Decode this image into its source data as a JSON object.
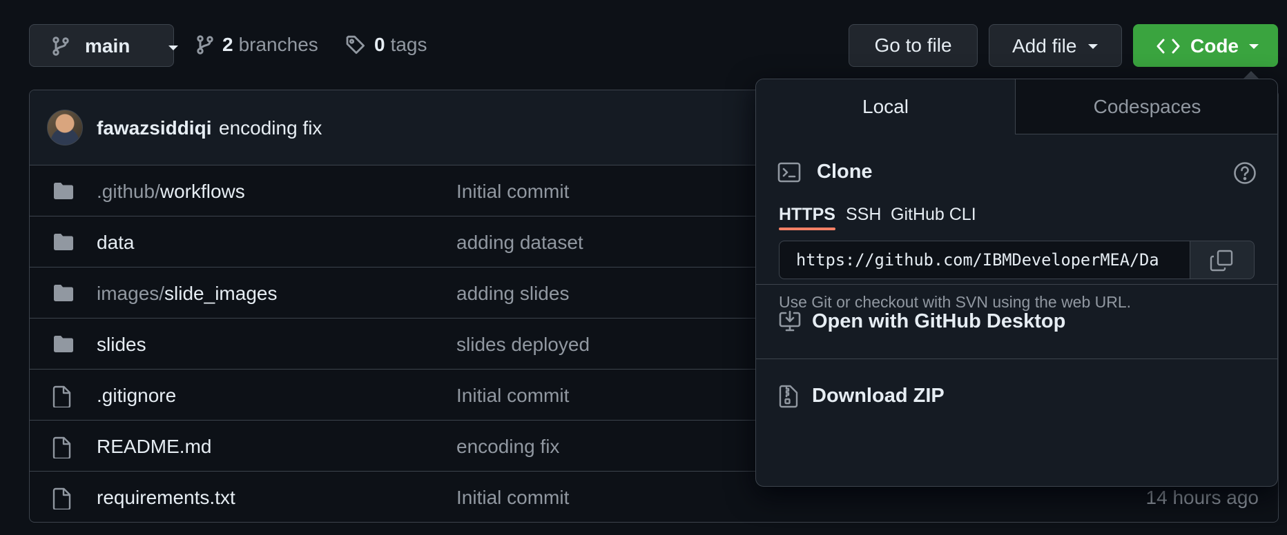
{
  "toolbar": {
    "branch": "main",
    "branches_count": "2",
    "branches_label": "branches",
    "tags_count": "0",
    "tags_label": "tags",
    "goto_file": "Go to file",
    "add_file": "Add file",
    "code": "Code"
  },
  "latest_commit": {
    "author": "fawazsiddiqi",
    "message": "encoding fix"
  },
  "files": [
    {
      "type": "folder",
      "prefix": ".github/",
      "name": "workflows",
      "message": "Initial commit",
      "age": ""
    },
    {
      "type": "folder",
      "prefix": "",
      "name": "data",
      "message": "adding dataset",
      "age": ""
    },
    {
      "type": "folder",
      "prefix": "images/",
      "name": "slide_images",
      "message": "adding slides",
      "age": ""
    },
    {
      "type": "folder",
      "prefix": "",
      "name": "slides",
      "message": "slides deployed",
      "age": ""
    },
    {
      "type": "file",
      "prefix": "",
      "name": ".gitignore",
      "message": "Initial commit",
      "age": ""
    },
    {
      "type": "file",
      "prefix": "",
      "name": "README.md",
      "message": "encoding fix",
      "age": ""
    },
    {
      "type": "file",
      "prefix": "",
      "name": "requirements.txt",
      "message": "Initial commit",
      "age": "14 hours ago"
    }
  ],
  "dropdown": {
    "tabs": [
      "Local",
      "Codespaces"
    ],
    "clone_title": "Clone",
    "protocols": [
      "HTTPS",
      "SSH",
      "GitHub CLI"
    ],
    "selected_protocol": "HTTPS",
    "clone_url": "https://github.com/IBMDeveloperMEA/Da",
    "help_text": "Use Git or checkout with SVN using the web URL.",
    "open_desktop": "Open with GitHub Desktop",
    "download_zip": "Download ZIP"
  },
  "colors": {
    "background": "#0d1117",
    "code_button": "#3aa43f",
    "tab_underline": "#f78166",
    "muted_text": "#9198a1"
  },
  "icons": {
    "branch": "git-branch-icon",
    "tag": "tag-icon",
    "code": "code-icon",
    "folder": "folder-icon",
    "file": "file-icon",
    "terminal": "terminal-icon",
    "help": "question-icon",
    "copy": "copy-icon",
    "desktop": "desktop-download-icon",
    "zip": "file-zip-icon"
  }
}
